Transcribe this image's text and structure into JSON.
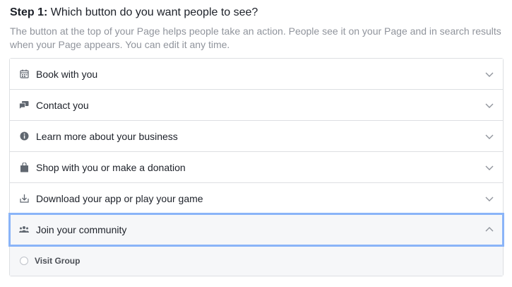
{
  "step": {
    "label": "Step 1:",
    "question": "Which button do you want people to see?",
    "description": "The button at the top of your Page helps people take an action. People see it on your Page and in search results when your Page appears. You can edit it any time."
  },
  "options": [
    {
      "label": "Book with you",
      "icon": "calendar-icon"
    },
    {
      "label": "Contact you",
      "icon": "chat-bubbles-icon"
    },
    {
      "label": "Learn more about your business",
      "icon": "info-icon"
    },
    {
      "label": "Shop with you or make a donation",
      "icon": "shopping-bag-icon"
    },
    {
      "label": "Download your app or play your game",
      "icon": "download-icon"
    },
    {
      "label": "Join your community",
      "icon": "people-icon",
      "expanded": true
    }
  ],
  "expanded_options": [
    {
      "label": "Visit Group",
      "selected": false
    }
  ],
  "colors": {
    "focus_ring": "#8ab4f8",
    "border": "#dddfe2",
    "muted_text": "#90949c",
    "icon": "#606770"
  }
}
